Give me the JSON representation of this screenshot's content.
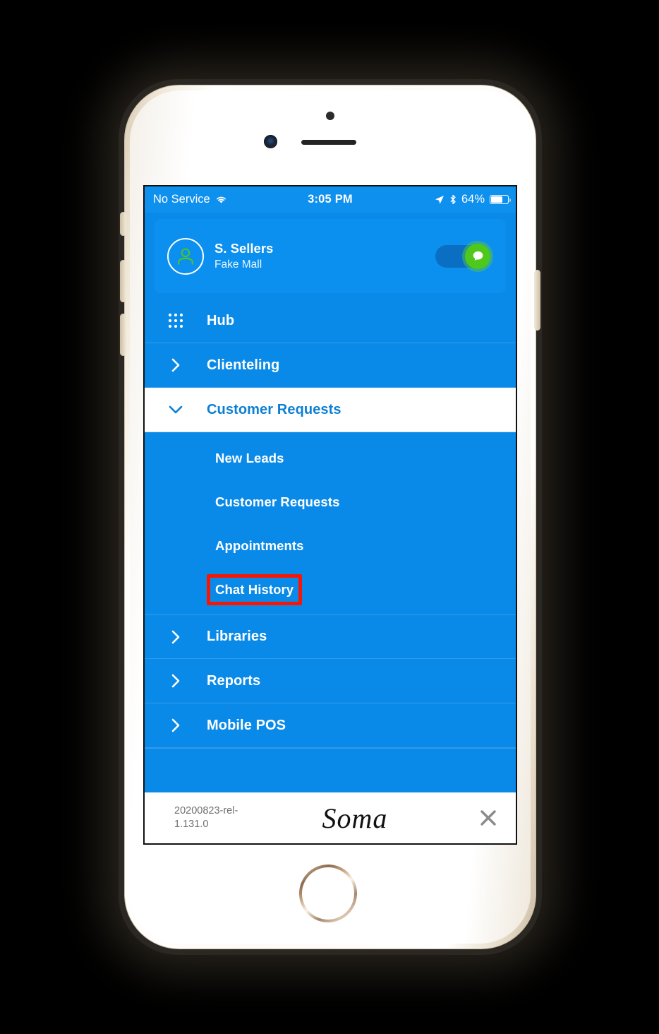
{
  "status_bar": {
    "carrier": "No Service",
    "wifi_icon": "wifi-icon",
    "time": "3:05 PM",
    "location_icon": "location-arrow-icon",
    "bluetooth_icon": "bluetooth-icon",
    "battery_percent": "64%",
    "battery_icon": "battery-icon",
    "battery_level": 64
  },
  "profile": {
    "avatar_icon": "user-avatar-icon",
    "name": "S. Sellers",
    "store": "Fake Mall",
    "toggle": {
      "name": "chat-availability-toggle",
      "state": "on",
      "knob_icon": "chat-bubble-icon"
    }
  },
  "nav": {
    "items": [
      {
        "label": "Hub",
        "icon": "grid-icon",
        "state": "default"
      },
      {
        "label": "Clienteling",
        "icon": "chevron-right-icon",
        "state": "collapsed"
      },
      {
        "label": "Customer Requests",
        "icon": "chevron-down-icon",
        "state": "expanded"
      },
      {
        "label": "Libraries",
        "icon": "chevron-right-icon",
        "state": "collapsed"
      },
      {
        "label": "Reports",
        "icon": "chevron-right-icon",
        "state": "collapsed"
      },
      {
        "label": "Mobile POS",
        "icon": "chevron-right-icon",
        "state": "collapsed"
      }
    ],
    "sub_items": [
      {
        "label": "New Leads",
        "highlighted": false
      },
      {
        "label": "Customer Requests",
        "highlighted": false
      },
      {
        "label": "Appointments",
        "highlighted": false
      },
      {
        "label": "Chat History",
        "highlighted": true
      }
    ]
  },
  "footer": {
    "version": "20200823-rel-1.131.0",
    "version_line1": "20200823-rel-",
    "version_line2": "1.131.0",
    "brand": "Soma",
    "close_icon": "close-x-icon"
  },
  "colors": {
    "menu_blue": "#0a8ae8",
    "status_blue": "#0e90ee",
    "card_blue": "#0b90f0",
    "active_text_blue": "#0b7fd4",
    "toggle_green": "#4ec81a",
    "highlight_red": "#f71505",
    "footer_white": "#ffffff"
  }
}
